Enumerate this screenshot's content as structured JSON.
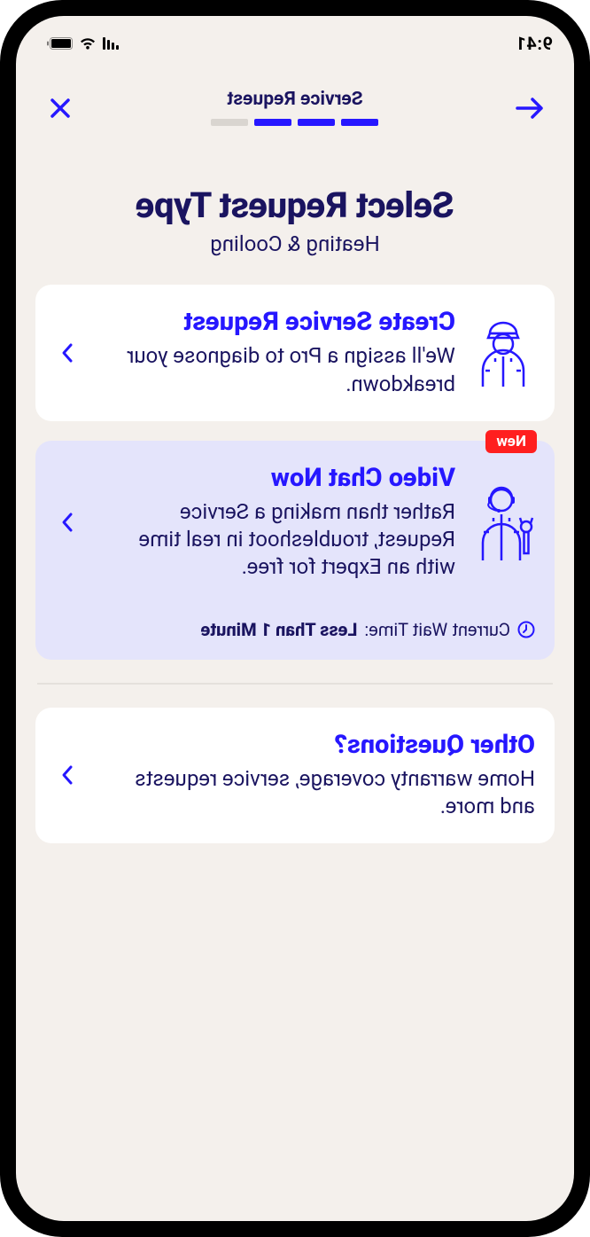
{
  "status": {
    "time": "9:41"
  },
  "nav": {
    "title": "Service Request"
  },
  "header": {
    "title": "Select Request Type",
    "subtitle": "Heating & Cooling"
  },
  "cards": {
    "create": {
      "title": "Create Service Request",
      "desc": "We'll assign a Pro to diagnose your breakdown."
    },
    "video": {
      "badge": "New",
      "title": "Video Chat Now",
      "desc": "Rather than making a Service Request, troubleshoot in real time with an Expert for free.",
      "wait_label": "Current Wait Time: ",
      "wait_value": "Less Than 1 Minute"
    },
    "other": {
      "title": "Other Questions?",
      "desc": "Home warranty coverage, service requests and more."
    }
  }
}
